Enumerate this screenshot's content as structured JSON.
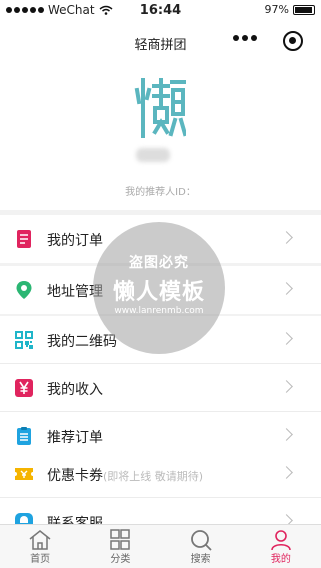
{
  "status_bar": {
    "carrier": "WeChat",
    "time": "16:44",
    "battery": "97%"
  },
  "nav": {
    "title": "轻商拼团"
  },
  "profile": {
    "avatar_char": "懒",
    "referrer_label": "我的推荐人ID："
  },
  "menu_group_1": [
    {
      "label": "我的订单",
      "icon": "order-icon",
      "color": "#e0245e"
    }
  ],
  "menu_group_2": [
    {
      "label": "地址管理",
      "icon": "location-pin-icon",
      "color": "#2bb673"
    }
  ],
  "menu_group_3": [
    {
      "label": "我的二维码",
      "icon": "qrcode-icon",
      "color": "#1fb5c9"
    },
    {
      "label": "我的收入",
      "icon": "yen-icon",
      "color": "#e0245e"
    },
    {
      "label": "推荐订单",
      "icon": "clipboard-icon",
      "color": "#1fa3e0"
    }
  ],
  "menu_group_4": [
    {
      "label": "优惠卡券",
      "note": "(即将上线 敬请期待)",
      "icon": "coupon-icon",
      "color": "#f5b400"
    },
    {
      "label": "联系客服",
      "icon": "service-icon",
      "color": "#1fa3e0"
    }
  ],
  "watermark": {
    "top": "盗图必究",
    "main": "懒人模板",
    "url": "www.lanrenmb.com"
  },
  "tabbar": [
    {
      "label": "首页",
      "icon": "home-icon"
    },
    {
      "label": "分类",
      "icon": "category-icon"
    },
    {
      "label": "搜索",
      "icon": "search-icon"
    },
    {
      "label": "我的",
      "icon": "profile-icon",
      "active": true
    }
  ]
}
